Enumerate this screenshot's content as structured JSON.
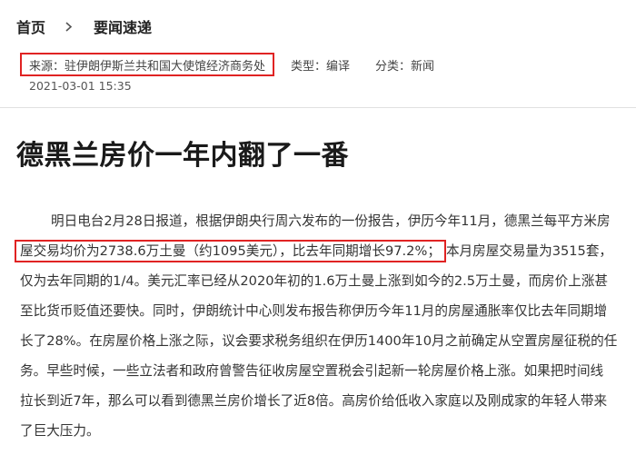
{
  "breadcrumb": {
    "home": "首页",
    "current": "要闻速递"
  },
  "meta": {
    "source": "来源：驻伊朗伊斯兰共和国大使馆经济商务处",
    "type": "类型：编译",
    "category": "分类：新闻",
    "date": "2021-03-01 15:35"
  },
  "article": {
    "title": "德黑兰房价一年内翻了一番",
    "lines": [
      "明日电台2月28日报道，根据伊朗央行周六发布的一份报告，伊历今年11月，德黑兰每平方米房",
      "屋交易均价为2738.6万土曼（约1095美元），比去年同期增长97.2%；",
      "本月房屋交易量为3515套，",
      "仅为去年同期的1/4。美元汇率已经从2020年初的1.6万土曼上涨到如今的2.5万土曼，而房价上涨甚",
      "至比货币贬值还要快。同时，伊朗统计中心则发布报告称伊历今年11月的房屋通胀率仅比去年同期增",
      "长了28%。在房屋价格上涨之际，议会要求税务组织在伊历1400年10月之前确定从空置房屋征税的任",
      "务。早些时候，一些立法者和政府曾警告征收房屋空置税会引起新一轮房屋价格上涨。如果把时间线",
      "拉长到近7年，那么可以看到德黑兰房价增长了近8倍。高房价给低收入家庭以及刚成家的年轻人带来",
      "了巨大压力。"
    ]
  }
}
